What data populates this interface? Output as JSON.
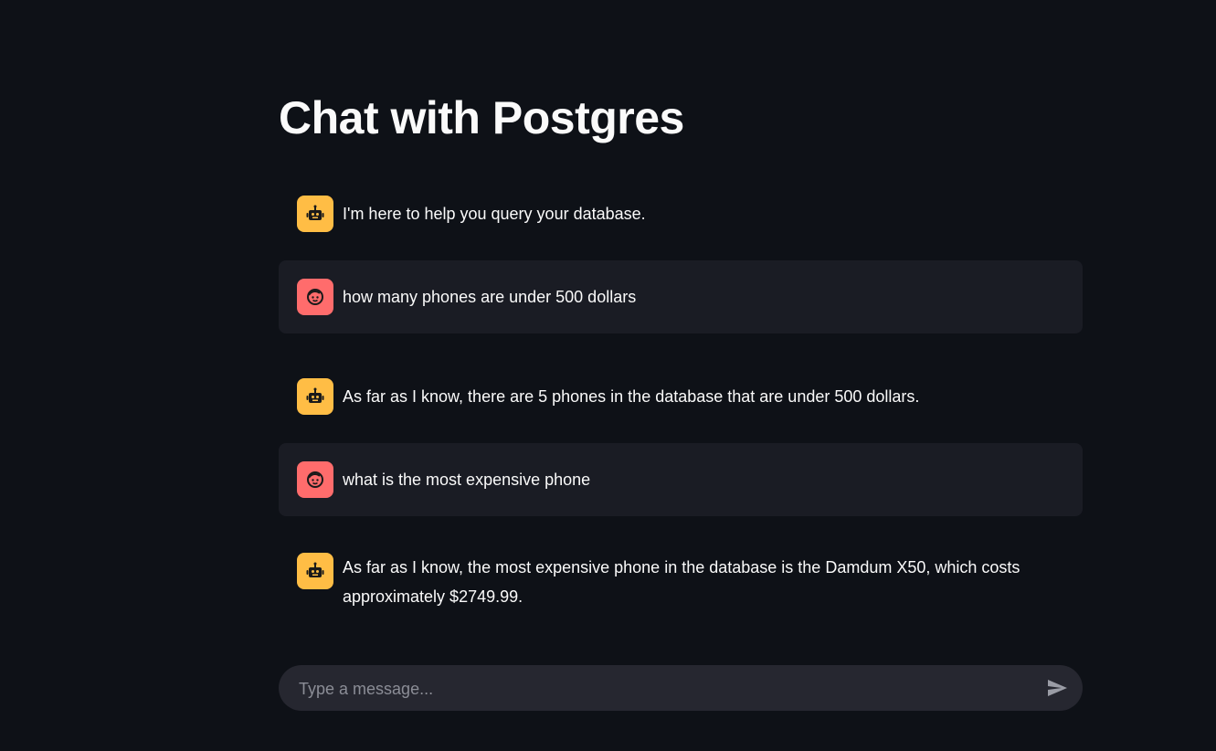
{
  "page": {
    "title": "Chat with Postgres"
  },
  "messages": [
    {
      "role": "assistant",
      "avatar_icon": "robot-icon",
      "text": "I'm here to help you query your database."
    },
    {
      "role": "user",
      "avatar_icon": "face-icon",
      "text": "how many phones are under 500 dollars"
    },
    {
      "role": "assistant",
      "avatar_icon": "robot-icon",
      "text": "As far as I know, there are 5 phones in the database that are under 500 dollars."
    },
    {
      "role": "user",
      "avatar_icon": "face-icon",
      "text": "what is the most expensive phone"
    },
    {
      "role": "assistant",
      "avatar_icon": "robot-icon",
      "text": "As far as I know, the most expensive phone in the database is the Damdum X50, which costs approximately $2749.99."
    }
  ],
  "chat_input": {
    "placeholder": "Type a message...",
    "value": "",
    "send_icon": "send-icon"
  },
  "colors": {
    "background": "#0e1117",
    "user_message_bg": "#1a1c24",
    "assistant_avatar": "#ffbd45",
    "user_avatar": "#ff6c6c",
    "input_bg": "#262730"
  }
}
